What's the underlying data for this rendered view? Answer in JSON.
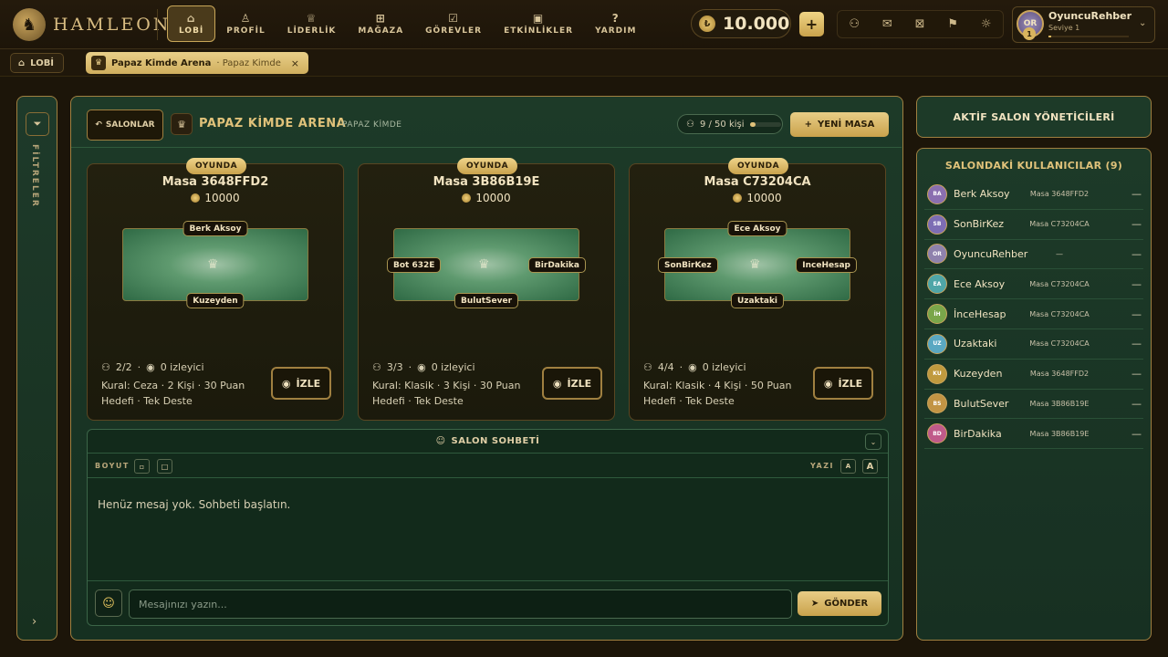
{
  "brand": {
    "logo_glyph": "♞",
    "name": "HAMLEON"
  },
  "nav": [
    {
      "label": "LOBİ",
      "icon": "⌂",
      "icon_name": "home-icon",
      "active": true
    },
    {
      "label": "PROFİL",
      "icon": "♙",
      "icon_name": "user-icon"
    },
    {
      "label": "LİDERLİK",
      "icon": "♕",
      "icon_name": "trophy-icon"
    },
    {
      "label": "MAĞAZA",
      "icon": "⊞",
      "icon_name": "cart-icon"
    },
    {
      "label": "GÖREVLER",
      "icon": "☑",
      "icon_name": "clipboard-icon"
    },
    {
      "label": "ETKİNLİKLER",
      "icon": "▣",
      "icon_name": "gift-icon"
    },
    {
      "label": "YARDIM",
      "icon": "?",
      "icon_name": "help-icon"
    }
  ],
  "wallet": {
    "coin_glyph": "₺",
    "balance": "10.000",
    "add_label": "+"
  },
  "header_icons": [
    {
      "glyph": "⚇",
      "name": "friends-icon"
    },
    {
      "glyph": "✉",
      "name": "mail-icon"
    },
    {
      "glyph": "⊠",
      "name": "gift-box-icon"
    },
    {
      "glyph": "⚑",
      "name": "flag-icon"
    },
    {
      "glyph": "☼",
      "name": "theme-icon"
    }
  ],
  "profile": {
    "initials": "OR",
    "level_num": "1",
    "name": "OyuncuRehber",
    "level_text": "Seviye 1",
    "xp_fraction": 0.03,
    "chevron": "⌄"
  },
  "breadcrumb": {
    "home_icon": "⌂",
    "home_label": "LOBİ",
    "tab_icon": "♛",
    "tab_title": "Papaz Kimde Arena",
    "tab_sub": "· Papaz Kimde",
    "close": "×"
  },
  "filters": {
    "icon": "⏷",
    "label": "FİLTRELER",
    "arrow": "›"
  },
  "arena": {
    "back_icon": "↶",
    "back_label": "SALONLAR",
    "icon": "♛",
    "title": "PAPAZ KİMDE ARENA",
    "subtitle": "PAPAZ KİMDE",
    "capacity_icon": "⚇",
    "capacity": "9 / 50 kişi",
    "capacity_fraction": 0.18,
    "new_table_icon": "+",
    "new_table_label": "YENİ MASA"
  },
  "tables": [
    {
      "status": "OYUNDA",
      "name": "Masa 3648FFD2",
      "stake": "10000",
      "seat_top": "Berk Aksoy",
      "seat_bottom": "Kuzeyden",
      "seat_left": "",
      "seat_right": "",
      "players": "2/2",
      "viewers": "0 izleyici",
      "rules": "Kural: Ceza · 2 Kişi · 30 Puan Hedefi · Tek Deste",
      "watch_label": "İZLE"
    },
    {
      "status": "OYUNDA",
      "name": "Masa 3B86B19E",
      "stake": "10000",
      "seat_top": "",
      "seat_bottom": "BulutSever",
      "seat_left": "Bot 632E",
      "seat_right": "BirDakika",
      "players": "3/3",
      "viewers": "0 izleyici",
      "rules": "Kural: Klasik · 3 Kişi · 30 Puan Hedefi · Tek Deste",
      "watch_label": "İZLE"
    },
    {
      "status": "OYUNDA",
      "name": "Masa C73204CA",
      "stake": "10000",
      "seat_top": "Ece Aksoy",
      "seat_bottom": "Uzaktaki",
      "seat_left": "SonBirKez",
      "seat_right": "InceHesap",
      "players": "4/4",
      "viewers": "0 izleyici",
      "rules": "Kural: Klasik · 4 Kişi · 50 Puan Hedefi · Tek Deste",
      "watch_label": "İZLE"
    }
  ],
  "table_icons": {
    "players": "⚇",
    "viewers": "◉",
    "watch": "◉",
    "crown": "♛"
  },
  "chat": {
    "icon": "☺",
    "title": "SALON SOHBETİ",
    "collapse": "⌄",
    "size_label": "BOYUT",
    "size_small": "▫",
    "size_large": "□",
    "font_label": "YAZI",
    "font_small": "A",
    "font_large": "A",
    "empty_text": "Henüz mesaj yok. Sohbeti başlatın.",
    "emoji": "☺",
    "placeholder": "Mesajınızı yazın...",
    "send_icon": "➤",
    "send_label": "GÖNDER"
  },
  "admins_title": "AKTİF SALON YÖNETİCİLERİ",
  "users": {
    "title": "SALONDAKİ KULLANICILAR (9)",
    "list": [
      {
        "initials": "BA",
        "name": "Berk Aksoy",
        "table": "Masa 3648FFD2",
        "status": "—",
        "color": "#8a6fb0"
      },
      {
        "initials": "SB",
        "name": "SonBirKez",
        "table": "Masa C73204CA",
        "status": "—",
        "color": "#7d6db4"
      },
      {
        "initials": "OR",
        "name": "OyuncuRehber",
        "table": "—",
        "status": "—",
        "color": "#8f82ad"
      },
      {
        "initials": "EA",
        "name": "Ece Aksoy",
        "table": "Masa C73204CA",
        "status": "—",
        "color": "#4fa6a8"
      },
      {
        "initials": "İH",
        "name": "İnceHesap",
        "table": "Masa C73204CA",
        "status": "—",
        "color": "#7aa64a"
      },
      {
        "initials": "UZ",
        "name": "Uzaktaki",
        "table": "Masa C73204CA",
        "status": "—",
        "color": "#5aa8c2"
      },
      {
        "initials": "KU",
        "name": "Kuzeyden",
        "table": "Masa 3648FFD2",
        "status": "—",
        "color": "#c09a3e"
      },
      {
        "initials": "BS",
        "name": "BulutSever",
        "table": "Masa 3B86B19E",
        "status": "—",
        "color": "#c29444"
      },
      {
        "initials": "BD",
        "name": "BirDakika",
        "table": "Masa 3B86B19E",
        "status": "—",
        "color": "#c05a8a"
      }
    ]
  }
}
